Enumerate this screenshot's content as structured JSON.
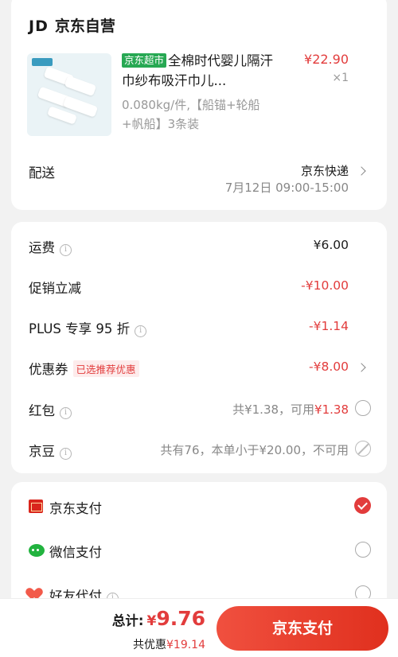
{
  "order": {
    "shop_logo": "JD",
    "shop_name": "京东自营",
    "product": {
      "badge": "京东超市",
      "title": "全棉时代婴儿隔汗巾纱布吸汗巾儿...",
      "price": "¥22.90",
      "qty": "×1",
      "spec": "0.080kg/件,【船锚+轮船+帆船】3条装"
    },
    "shipping": {
      "label": "配送",
      "method": "京东快递",
      "time": "7月12日 09:00-15:00"
    }
  },
  "fees": {
    "freight": {
      "label": "运费",
      "value": "¥6.00"
    },
    "promo": {
      "label": "促销立减",
      "value": "-¥10.00"
    },
    "plus": {
      "label": "PLUS 专享 95 折",
      "value": "-¥1.14"
    },
    "coupon": {
      "label": "优惠券",
      "badge": "已选推荐优惠",
      "value": "-¥8.00"
    },
    "redpacket": {
      "label": "红包",
      "note_prefix": "共¥1.38，可用",
      "note_amount": "¥1.38"
    },
    "jingdou": {
      "label": "京豆",
      "note": "共有76，本单小于¥20.00，不可用"
    }
  },
  "payment": {
    "methods": [
      {
        "label": "京东支付",
        "icon": "jd-pay-icon",
        "selected": true
      },
      {
        "label": "微信支付",
        "icon": "wechat-pay-icon",
        "selected": false
      },
      {
        "label": "好友代付",
        "icon": "friend-pay-icon",
        "selected": false
      }
    ]
  },
  "footer": {
    "total_label": "总计:",
    "total_currency": "¥",
    "total_amount": "9.76",
    "saved_prefix": "共优惠",
    "saved_amount": "¥19.14",
    "pay_button": "京东支付"
  },
  "colors": {
    "accent": "#e23c3c",
    "badge_green": "#27a853",
    "wechat_green": "#22b33f"
  }
}
